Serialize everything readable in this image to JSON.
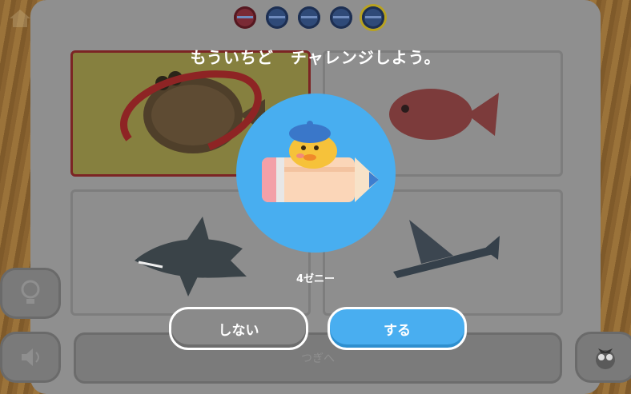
{
  "dialog": {
    "title": "もういちど　チャレンジしよう。",
    "price": "4ゼニー",
    "no_label": "しない",
    "yes_label": "する"
  },
  "footer": {
    "next_label": "つぎへ"
  },
  "progress": {
    "total": 5,
    "current": 5
  },
  "icons": {
    "home": "home-icon",
    "hint": "lightbulb-icon",
    "sound": "speaker-icon",
    "helper": "owl-icon"
  },
  "colors": {
    "accent_blue": "#48aef0",
    "selected_border": "#7c2424"
  }
}
